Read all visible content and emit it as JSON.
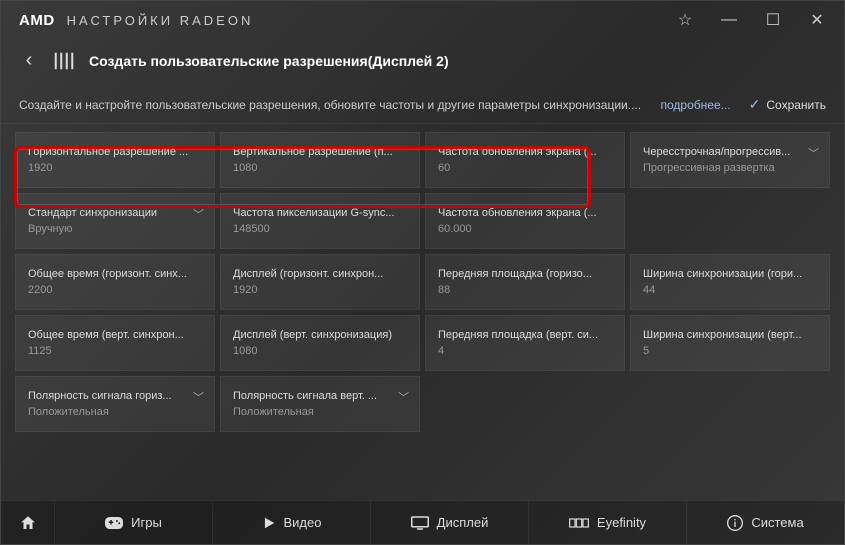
{
  "app": {
    "brand": "AMD",
    "title": "НАСТРОЙКИ RADEON"
  },
  "header": {
    "page_title": "Создать пользовательские разрешения(Дисплей 2)"
  },
  "inforow": {
    "text": "Создайте и настройте пользовательские разрешения, обновите частоты и другие параметры синхронизации....",
    "more_label": "подробнее...",
    "save_label": "Сохранить"
  },
  "tiles": [
    {
      "label": "Горизонтальное разрешение ...",
      "value": "1920",
      "chevron": false
    },
    {
      "label": "Вертикальное разрешение (п...",
      "value": "1080",
      "chevron": false
    },
    {
      "label": "Частота обновления экрана (...",
      "value": "60",
      "chevron": false
    },
    {
      "label": "Чересстрочная/прогрессив...",
      "value": "Прогрессивная развертка",
      "chevron": true
    },
    {
      "label": "Стандарт синхронизации",
      "value": "Вручную",
      "chevron": true
    },
    {
      "label": "Частота пикселизации G-sync...",
      "value": "148500",
      "chevron": false
    },
    {
      "label": "Частота обновления экрана (...",
      "value": "60.000",
      "chevron": false
    },
    {
      "label": "",
      "value": "",
      "chevron": false,
      "empty": true
    },
    {
      "label": "Общее время (горизонт. синх...",
      "value": "2200",
      "chevron": false
    },
    {
      "label": "Дисплей (горизонт. синхрон...",
      "value": "1920",
      "chevron": false
    },
    {
      "label": "Передняя площадка (горизо...",
      "value": "88",
      "chevron": false
    },
    {
      "label": "Ширина синхронизации (гори...",
      "value": "44",
      "chevron": false
    },
    {
      "label": "Общее время (верт. синхрон...",
      "value": "1125",
      "chevron": false
    },
    {
      "label": "Дисплей (верт. синхронизация)",
      "value": "1080",
      "chevron": false
    },
    {
      "label": "Передняя площадка (верт. си...",
      "value": "4",
      "chevron": false
    },
    {
      "label": "Ширина синхронизации (верт...",
      "value": "5",
      "chevron": false
    },
    {
      "label": "Полярность сигнала гориз...",
      "value": "Положительная",
      "chevron": true
    },
    {
      "label": "Полярность сигнала верт. ...",
      "value": "Положительная",
      "chevron": true
    },
    {
      "label": "",
      "value": "",
      "chevron": false,
      "empty": true
    },
    {
      "label": "",
      "value": "",
      "chevron": false,
      "empty": true
    }
  ],
  "nav": {
    "games": "Игры",
    "video": "Видео",
    "display": "Дисплей",
    "eyefinity": "Eyefinity",
    "system": "Система"
  }
}
